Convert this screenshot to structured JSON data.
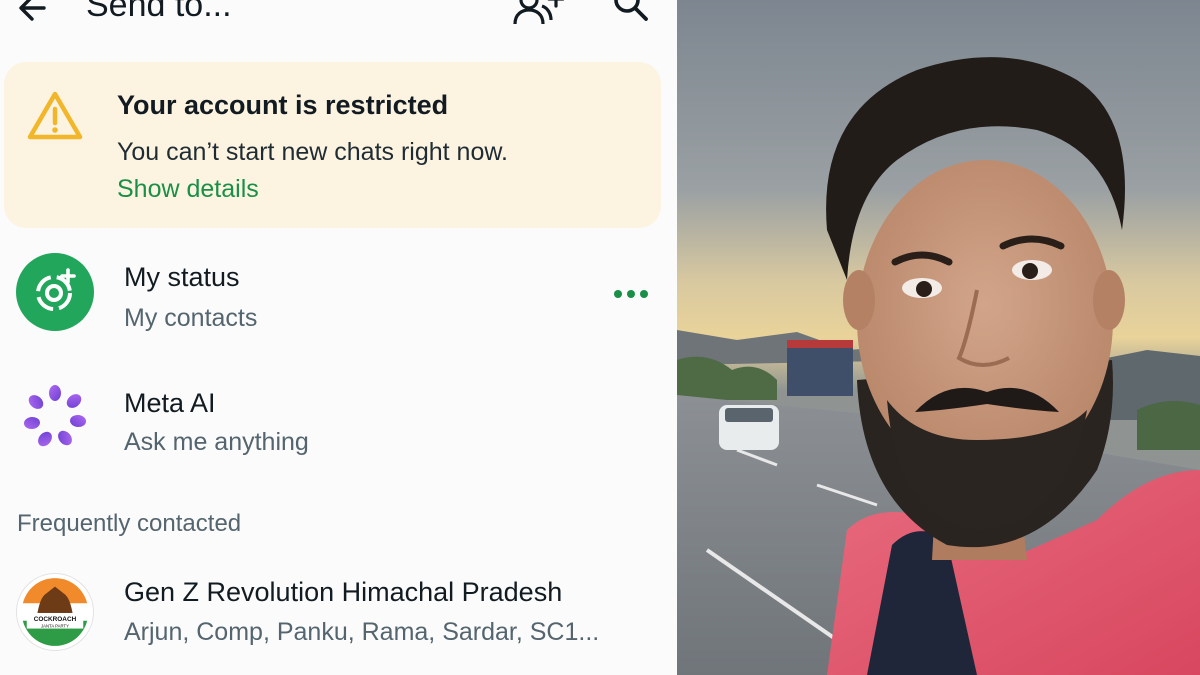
{
  "header": {
    "title": "Send to..."
  },
  "banner": {
    "title": "Your account is restricted",
    "subtitle": "You can’t start new chats right now.",
    "link": "Show details"
  },
  "status_row": {
    "name": "My status",
    "subtitle": "My contacts"
  },
  "meta_row": {
    "name": "Meta AI",
    "subtitle": "Ask me anything"
  },
  "section_title": "Frequently contacted",
  "group_row": {
    "name": "Gen Z Revolution Himachal Pradesh",
    "subtitle": "Arjun, Comp, Panku, Rama, Sardar, SC1...",
    "avatar_text": "COCKROACH",
    "avatar_subtext": "JANTA PARTY"
  },
  "colors": {
    "accent_green": "#1a8f47",
    "status_green": "#22a65b",
    "banner_bg": "#fcf3e1",
    "warning_yellow": "#f2b62a"
  },
  "icons": [
    "back-arrow-icon",
    "add-contact-icon",
    "search-icon",
    "warning-icon",
    "status-add-icon",
    "more-dots-icon",
    "meta-ai-icon"
  ]
}
